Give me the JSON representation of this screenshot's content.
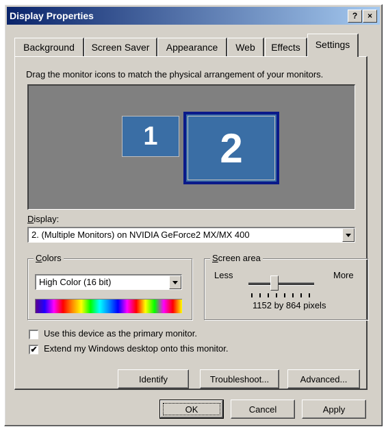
{
  "window": {
    "title": "Display Properties",
    "help_button": "?",
    "close_button": "×"
  },
  "tabs": [
    "Background",
    "Screen Saver",
    "Appearance",
    "Web",
    "Effects",
    "Settings"
  ],
  "active_tab": "Settings",
  "settings": {
    "instructions": "Drag the monitor icons to match the physical arrangement of your monitors.",
    "monitors": [
      {
        "number": "1",
        "selected": false
      },
      {
        "number": "2",
        "selected": true
      }
    ],
    "display_label": "Display:",
    "display_value": "2. (Multiple Monitors) on NVIDIA GeForce2 MX/MX 400",
    "colors_group_label": "Colors",
    "colors_value": "High Color (16 bit)",
    "screen_area_group_label": "Screen area",
    "screen_area_less": "Less",
    "screen_area_more": "More",
    "screen_area_value": "1152 by 864 pixels",
    "screen_area_level_fraction": 0.38,
    "primary_monitor_label": "Use this device as the primary monitor.",
    "primary_monitor_checked": false,
    "extend_desktop_label": "Extend my Windows desktop onto this monitor.",
    "extend_desktop_checked": true,
    "identify_label": "Identify",
    "troubleshoot_label": "Troubleshoot...",
    "advanced_label": "Advanced..."
  },
  "footer": {
    "ok_label": "OK",
    "cancel_label": "Cancel",
    "apply_label": "Apply"
  },
  "colors": {
    "titlebar_start": "#0a246a",
    "titlebar_end": "#a6caf0",
    "face": "#d4d0c8",
    "monitor_area": "#808080",
    "monitor_fill": "#3a6ea5",
    "selected_border": "#0a1a8a"
  }
}
